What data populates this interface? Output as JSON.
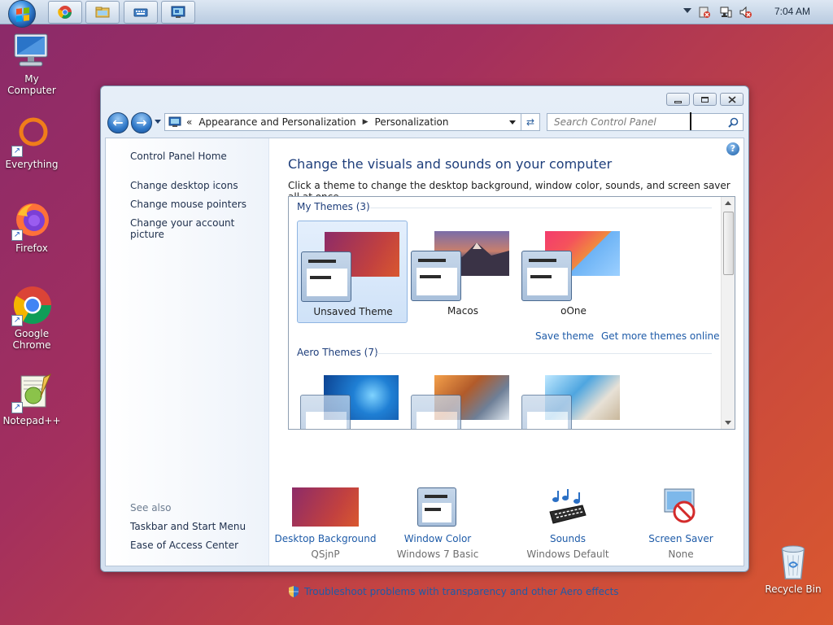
{
  "taskbar": {
    "clock": "7:04 AM",
    "buttons": [
      "chrome-taskbar-button",
      "explorer-taskbar-button",
      "keyboard-taskbar-button",
      "control-panel-taskbar-button"
    ]
  },
  "desktop": {
    "icons": [
      {
        "label": "My Computer",
        "icon": "computer-icon"
      },
      {
        "label": "Everything",
        "icon": "everything-icon"
      },
      {
        "label": "Firefox",
        "icon": "firefox-icon"
      },
      {
        "label": "Google Chrome",
        "icon": "chrome-icon"
      },
      {
        "label": "Notepad++",
        "icon": "notepadpp-icon"
      },
      {
        "label": "Recycle Bin",
        "icon": "recycle-bin-icon"
      }
    ]
  },
  "window": {
    "breadcrumb": {
      "overflow": "«",
      "items": [
        "Appearance and Personalization",
        "Personalization"
      ]
    },
    "search_placeholder": "Search Control Panel",
    "left_pane": {
      "home": "Control Panel Home",
      "links": [
        "Change desktop icons",
        "Change mouse pointers",
        "Change your account picture"
      ],
      "see_also_label": "See also",
      "see_also": [
        "Taskbar and Start Menu",
        "Ease of Access Center"
      ]
    },
    "main": {
      "title": "Change the visuals and sounds on your computer",
      "subtitle": "Click a theme to change the desktop background, window color, sounds, and screen saver all at once.",
      "my_themes_header": "My Themes (3)",
      "my_themes": [
        {
          "name": "Unsaved Theme",
          "selected": true
        },
        {
          "name": "Macos",
          "selected": false
        },
        {
          "name": "oOne",
          "selected": false
        }
      ],
      "save_theme": "Save theme",
      "get_more": "Get more themes online",
      "aero_header": "Aero Themes (7)",
      "bottom": [
        {
          "name": "Desktop Background",
          "value": "QSjnP"
        },
        {
          "name": "Window Color",
          "value": "Windows 7 Basic"
        },
        {
          "name": "Sounds",
          "value": "Windows Default"
        },
        {
          "name": "Screen Saver",
          "value": "None"
        }
      ],
      "troubleshoot": "Troubleshoot problems with transparency and other Aero effects"
    }
  }
}
